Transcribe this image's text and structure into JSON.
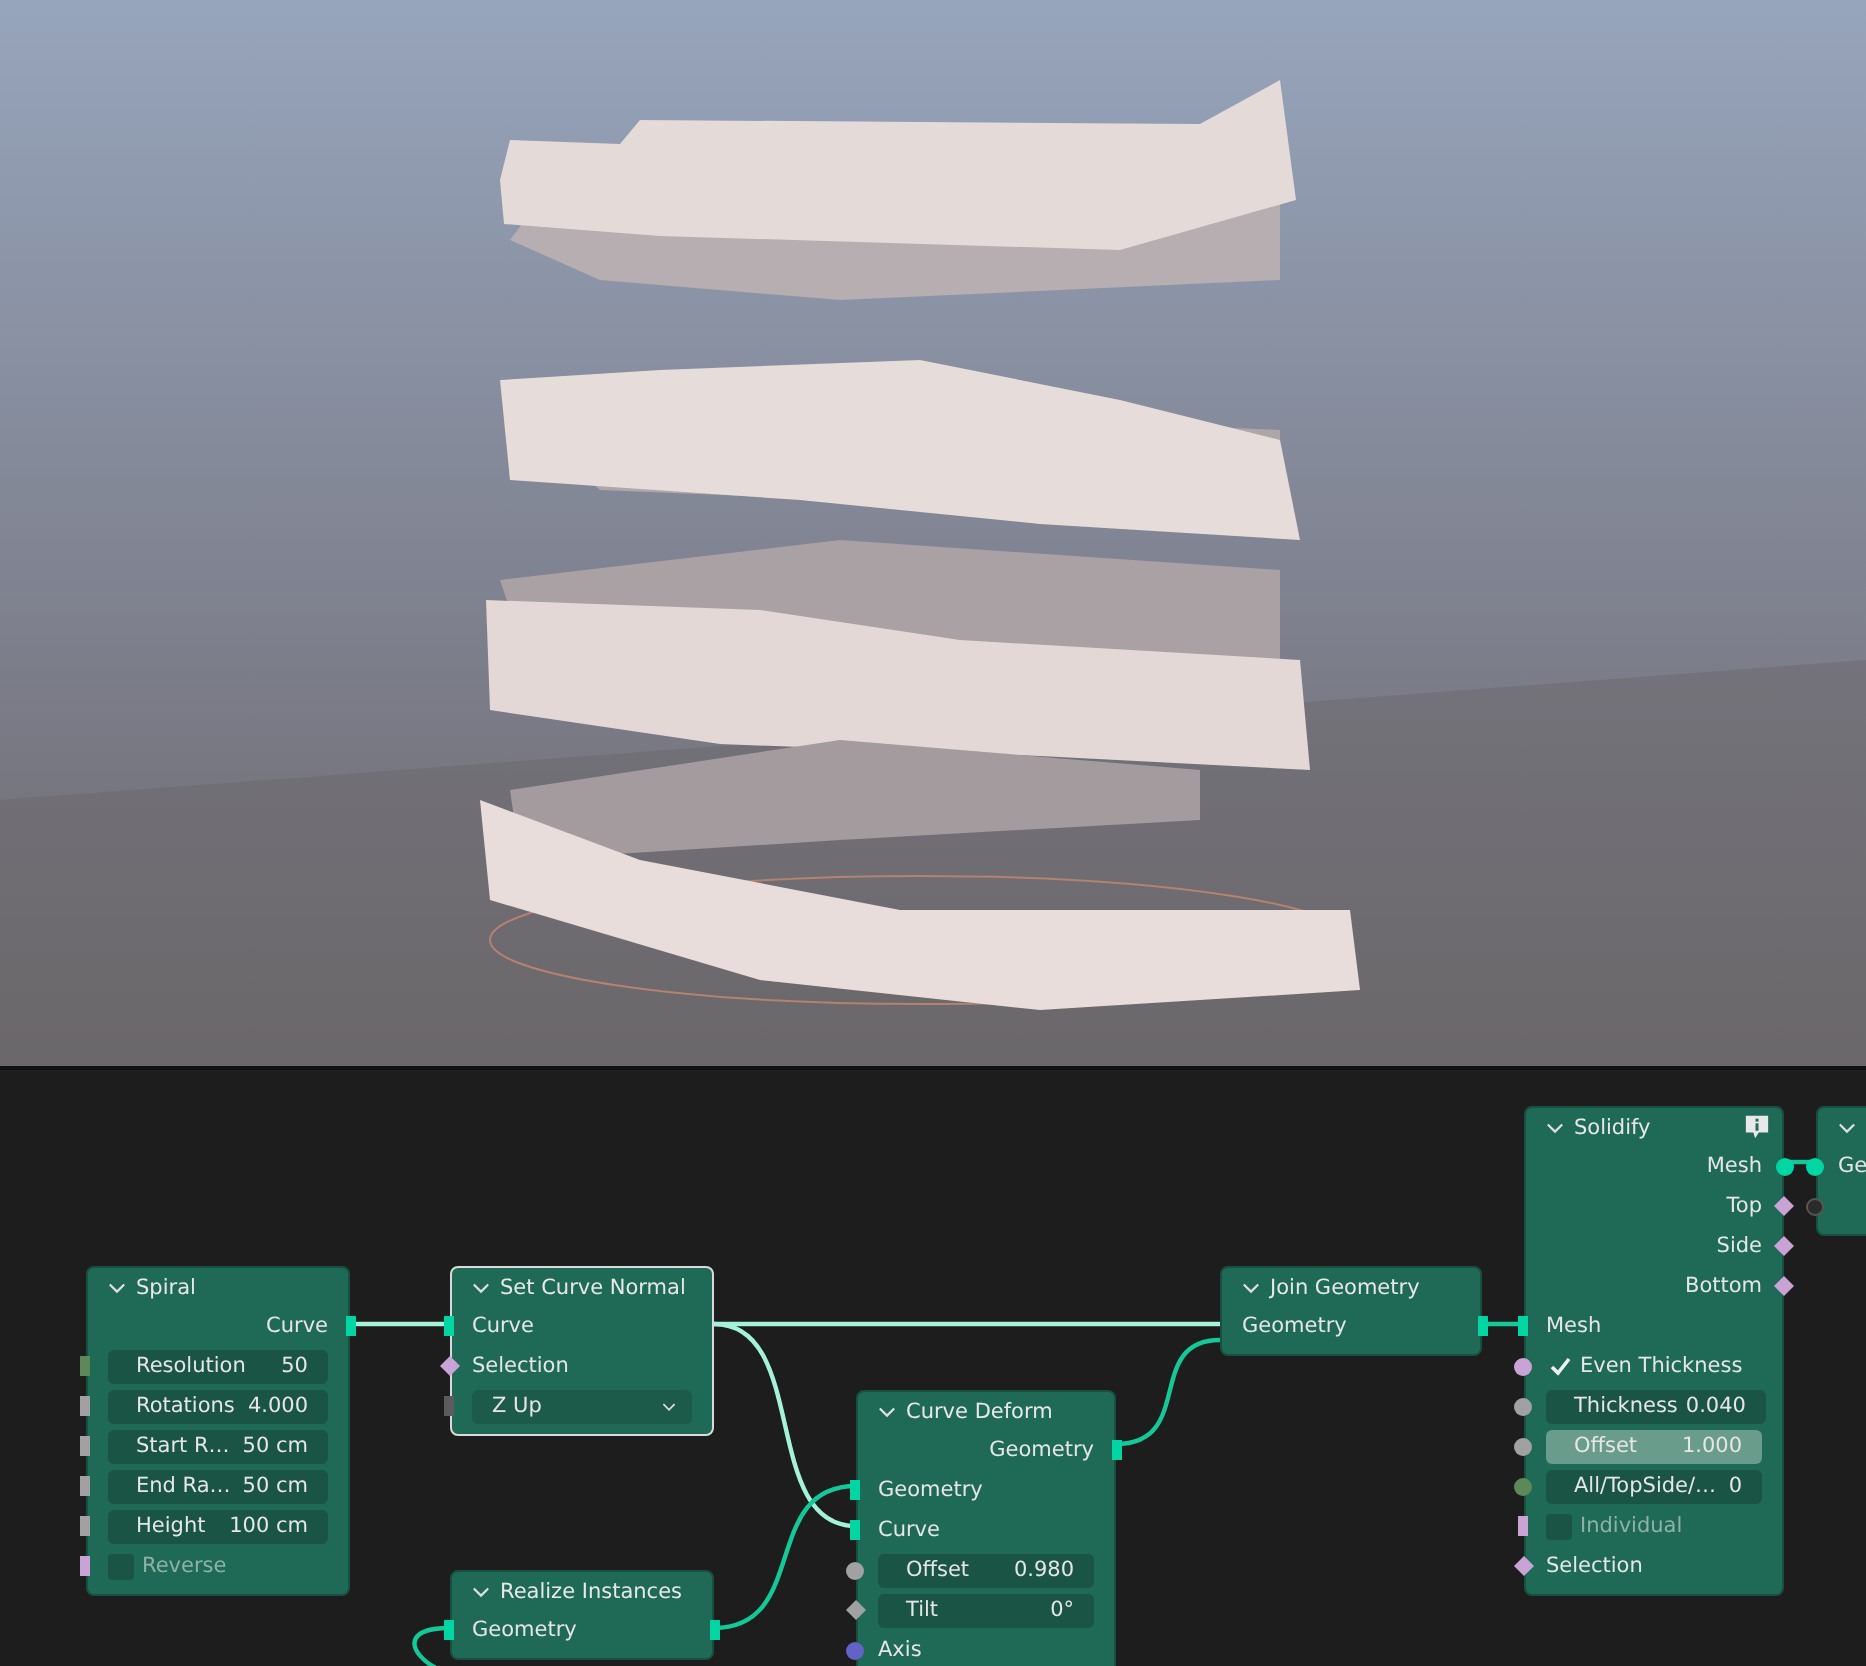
{
  "node_editor": {
    "nodes": [
      {
        "title": "Spiral",
        "selected": false,
        "info": false,
        "rows": [
          {
            "kind": "output",
            "label": "Curve",
            "socket": {
              "kind": "geometry"
            }
          },
          {
            "kind": "field",
            "label": "Resolution",
            "value": "50",
            "socket": {
              "kind": "int_single"
            },
            "highlighted": false
          },
          {
            "kind": "field",
            "label": "Rotations",
            "value": "4.000",
            "socket": {
              "kind": "float_single"
            },
            "highlighted": false
          },
          {
            "kind": "field",
            "label": "Start R…",
            "value": "50 cm",
            "socket": {
              "kind": "float_single"
            },
            "highlighted": false
          },
          {
            "kind": "field",
            "label": "End Ra…",
            "value": "50 cm",
            "socket": {
              "kind": "float_single"
            },
            "highlighted": false
          },
          {
            "kind": "field",
            "label": "Height",
            "value": "100 cm",
            "socket": {
              "kind": "float_single"
            },
            "highlighted": false
          },
          {
            "kind": "checkbox",
            "label": "Reverse",
            "checked": false,
            "socket": {
              "kind": "bool_single"
            }
          }
        ]
      },
      {
        "title": "Set Curve Normal",
        "selected": true,
        "info": false,
        "rows": [
          {
            "kind": "input",
            "label": "Curve",
            "socket": {
              "kind": "geometry"
            }
          },
          {
            "kind": "input",
            "label": "Selection",
            "socket": {
              "kind": "field_bool"
            }
          },
          {
            "kind": "dropdown",
            "label": "Z Up",
            "socket": {
              "kind": "menu"
            }
          }
        ]
      },
      {
        "title": "Realize Instances",
        "selected": false,
        "info": false,
        "rows": [
          {
            "kind": "passthrough",
            "label": "Geometry",
            "socket": {
              "kind": "geometry"
            }
          }
        ]
      },
      {
        "title": "Curve Deform",
        "selected": false,
        "info": false,
        "rows": [
          {
            "kind": "output",
            "label": "Geometry",
            "socket": {
              "kind": "geometry"
            }
          },
          {
            "kind": "input",
            "label": "Geometry",
            "socket": {
              "kind": "geometry"
            }
          },
          {
            "kind": "input",
            "label": "Curve",
            "socket": {
              "kind": "geometry"
            }
          },
          {
            "kind": "field",
            "label": "Offset",
            "value": "0.980",
            "socket": {
              "kind": "float"
            },
            "highlighted": false
          },
          {
            "kind": "field",
            "label": "Tilt",
            "value": "0°",
            "socket": {
              "kind": "field_float"
            },
            "highlighted": false
          },
          {
            "kind": "input",
            "label": "Axis",
            "socket": {
              "kind": "vector"
            }
          }
        ]
      },
      {
        "title": "Join Geometry",
        "selected": false,
        "info": false,
        "rows": [
          {
            "kind": "passthrough",
            "label": "Geometry",
            "socket": {
              "kind": "multi"
            }
          }
        ]
      },
      {
        "title": "Solidify",
        "selected": false,
        "info": true,
        "rows": [
          {
            "kind": "output",
            "label": "Mesh",
            "socket": {
              "kind": "mesh"
            }
          },
          {
            "kind": "output",
            "label": "Top",
            "socket": {
              "kind": "field_bool"
            }
          },
          {
            "kind": "output",
            "label": "Side",
            "socket": {
              "kind": "field_bool"
            }
          },
          {
            "kind": "output",
            "label": "Bottom",
            "socket": {
              "kind": "field_bool"
            }
          },
          {
            "kind": "input",
            "label": "Mesh",
            "socket": {
              "kind": "geometry"
            }
          },
          {
            "kind": "checkbox",
            "label": "Even Thickness",
            "checked": true,
            "socket": {
              "kind": "bool"
            }
          },
          {
            "kind": "field",
            "label": "Thickness",
            "value": "0.040",
            "socket": {
              "kind": "float"
            },
            "highlighted": false
          },
          {
            "kind": "field",
            "label": "Offset",
            "value": "1.000",
            "socket": {
              "kind": "float"
            },
            "highlighted": true
          },
          {
            "kind": "field",
            "label": "All/TopSide/…",
            "value": "0",
            "socket": {
              "kind": "int"
            },
            "highlighted": false
          },
          {
            "kind": "checkbox",
            "label": "Individual",
            "checked": false,
            "socket": {
              "kind": "bool_single"
            }
          },
          {
            "kind": "input",
            "label": "Selection",
            "socket": {
              "kind": "field_bool"
            }
          }
        ]
      },
      {
        "selected": false,
        "info": false,
        "rows": [
          {
            "kind": "input",
            "label": "Ge",
            "socket": {
              "kind": "mesh"
            }
          },
          {
            "kind": "input",
            "socket": {
              "kind": "empty"
            }
          }
        ]
      }
    ]
  }
}
